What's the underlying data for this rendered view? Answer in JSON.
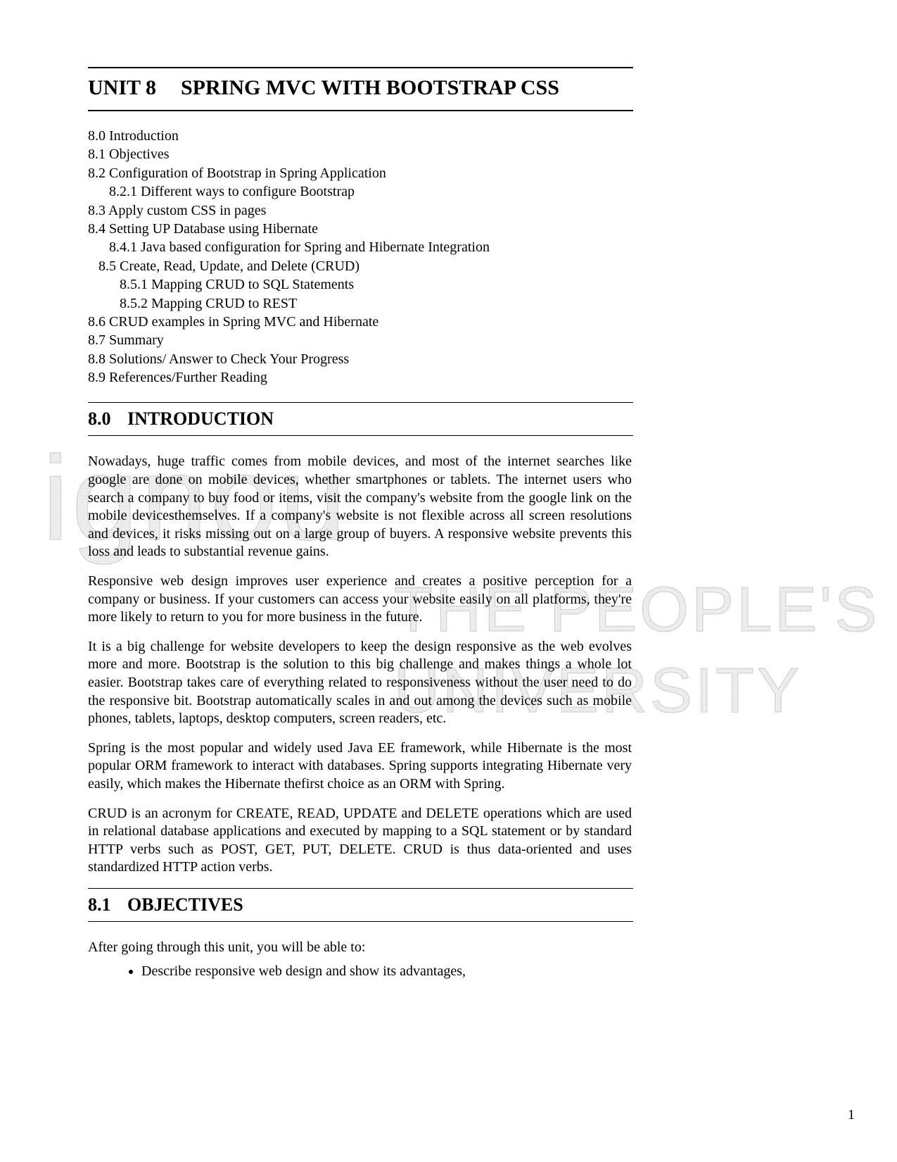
{
  "unit": {
    "number": "UNIT 8",
    "title": "SPRING MVC WITH BOOTSTRAP CSS"
  },
  "toc": [
    "8.0 Introduction",
    "8.1 Objectives",
    "8.2 Configuration of Bootstrap in Spring Application",
    "      8.2.1 Different ways to configure Bootstrap",
    "8.3 Apply custom CSS in pages",
    "8.4 Setting UP Database using Hibernate",
    "      8.4.1 Java based configuration for Spring and Hibernate Integration",
    "   8.5 Create, Read, Update, and Delete (CRUD)",
    "         8.5.1 Mapping CRUD to SQL Statements",
    "         8.5.2 Mapping CRUD to REST",
    "8.6 CRUD examples in Spring MVC and Hibernate",
    "8.7 Summary",
    "8.8 Solutions/ Answer to Check Your Progress",
    "8.9 References/Further Reading"
  ],
  "section_intro": {
    "num": "8.0",
    "label": "INTRODUCTION"
  },
  "paras": {
    "p1": "Nowadays, huge traffic comes from mobile devices, and most of the internet searches like google are done on mobile devices, whether smartphones or tablets. The internet users who search a company to buy food or items, visit the company's website from the google link on the mobile devicesthemselves. If a company's website is not flexible across all screen resolutions and devices, it risks missing out on a large group of buyers. A responsive website prevents this loss and leads to substantial revenue gains.",
    "p2": "Responsive web design improves user experience and creates a positive perception for a company or business. If your customers can access your website easily on all platforms, they're more likely to return to you for more business in the future.",
    "p3": "It is a big challenge for website developers to keep the design responsive as the web evolves more and more. Bootstrap is the solution to this big challenge and makes things a whole lot easier. Bootstrap takes care of everything related to responsiveness without the user need to do the responsive bit. Bootstrap automatically scales in and out among the devices such as mobile phones, tablets, laptops, desktop computers, screen readers, etc.",
    "p4": "Spring is the most popular and widely used Java EE framework, while Hibernate is the most popular ORM framework to interact with databases. Spring supports integrating Hibernate very easily, which makes the Hibernate thefirst choice as an ORM with Spring.",
    "p5": "CRUD is an acronym for CREATE, READ, UPDATE and DELETE operations which are used in relational database applications and executed by mapping to a SQL statement or by standard HTTP verbs such as POST, GET, PUT, DELETE. CRUD is thus data-oriented and uses standardized HTTP action verbs."
  },
  "section_obj": {
    "num": "8.1",
    "label": "OBJECTIVES"
  },
  "objectives_intro": "After going through this unit, you will be able to:",
  "objectives": [
    "Describe responsive web design and show its advantages,"
  ],
  "watermark": {
    "line1": "ignou",
    "line2": "THE PEOPLE'S",
    "line3": "UNIVERSITY"
  },
  "page_number": "1"
}
